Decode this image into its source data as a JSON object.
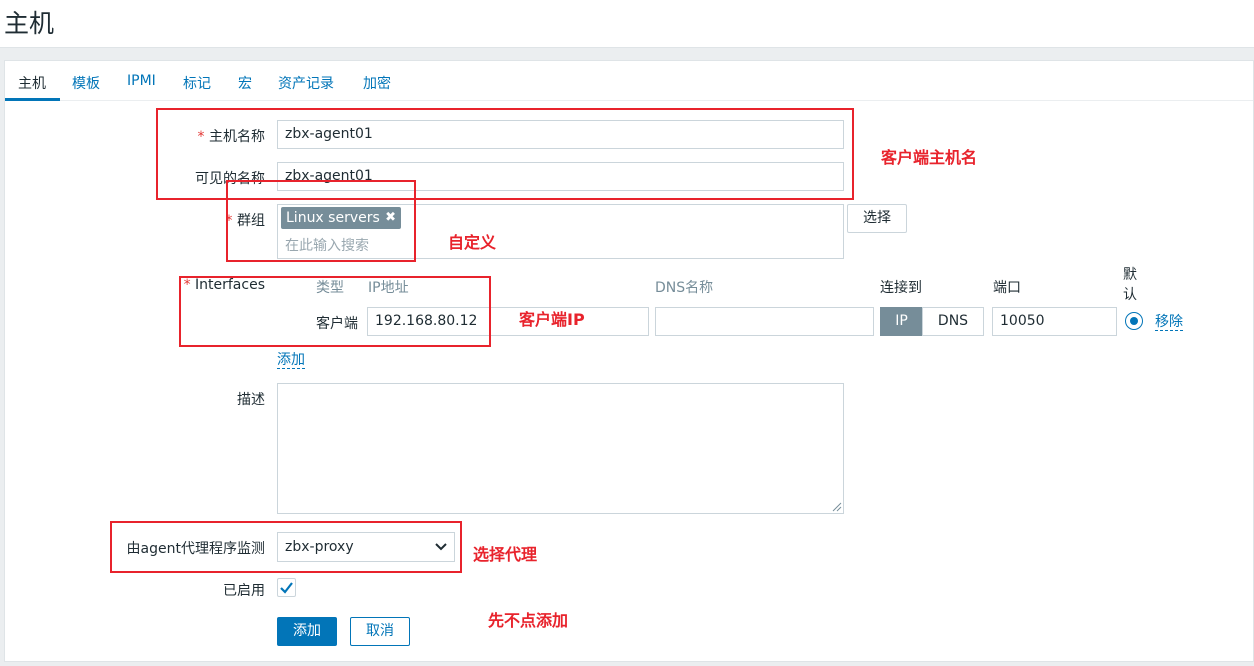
{
  "page": {
    "title": "主机"
  },
  "tabs": [
    {
      "label": "主机"
    },
    {
      "label": "模板"
    },
    {
      "label": "IPMI"
    },
    {
      "label": "标记"
    },
    {
      "label": "宏"
    },
    {
      "label": "资产记录"
    },
    {
      "label": "加密"
    }
  ],
  "form": {
    "host_name": {
      "required_mark": "*",
      "label": "主机名称",
      "value": "zbx-agent01"
    },
    "visible_name": {
      "label": "可见的名称",
      "value": "zbx-agent01"
    },
    "groups": {
      "required_mark": "*",
      "label": "群组",
      "chip": "Linux servers",
      "placeholder": "在此输入搜索",
      "select_label": "选择"
    },
    "interfaces": {
      "required_mark": "*",
      "label": "Interfaces",
      "columns": {
        "type": "类型",
        "ip": "IP地址",
        "dns": "DNS名称",
        "connect": "连接到",
        "port": "端口",
        "default": "默认"
      },
      "row": {
        "type": "客户端",
        "ip": "192.168.80.12",
        "dns": "",
        "connect_ip": "IP",
        "connect_dns": "DNS",
        "port": "10050",
        "remove": "移除"
      },
      "add": "添加"
    },
    "description": {
      "label": "描述",
      "value": ""
    },
    "proxy": {
      "label": "由agent代理程序监测",
      "value": "zbx-proxy"
    },
    "enabled": {
      "label": "已启用",
      "checked": true
    },
    "buttons": {
      "submit": "添加",
      "cancel": "取消"
    }
  },
  "annotations": {
    "hostname_note": "客户端主机名",
    "group_note": "自定义",
    "ip_note": "客户端IP",
    "proxy_note": "选择代理",
    "add_note": "先不点添加"
  },
  "colors": {
    "accent": "#0275b8",
    "annotation": "#e8232c",
    "chip": "#768d99"
  }
}
